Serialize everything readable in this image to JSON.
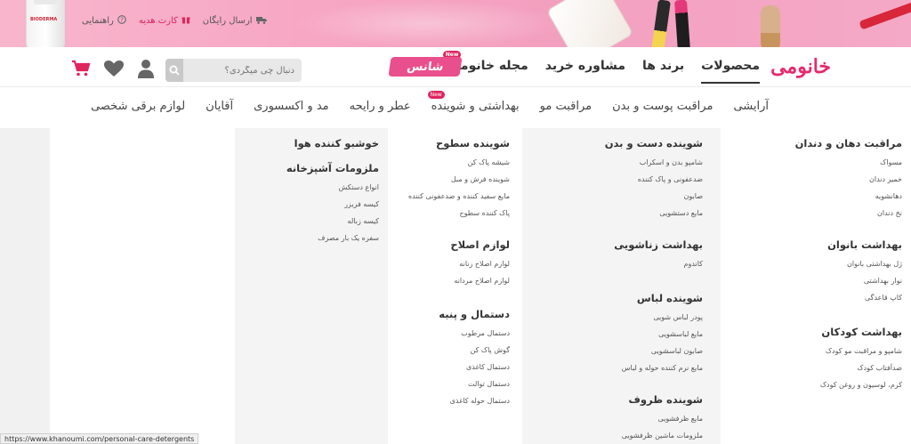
{
  "topbar": {
    "links": [
      {
        "label": "ارسال رایگان",
        "icon": "truck-icon"
      },
      {
        "label": "کارت هدیه",
        "icon": "gift-icon"
      },
      {
        "label": "راهنمایی",
        "icon": "question-icon"
      }
    ],
    "bottle_label": "BIODERMA"
  },
  "header": {
    "logo": "خانومی",
    "nav": [
      {
        "label": "محصولات",
        "active": true
      },
      {
        "label": "برند ها"
      },
      {
        "label": "مشاوره خرید"
      },
      {
        "label": "مجله خانومی",
        "badge": "New"
      }
    ],
    "chance": "شانس",
    "search_placeholder": "دنبال چی میگردی؟",
    "icons": [
      "search-icon",
      "user-icon",
      "heart-icon",
      "cart-icon"
    ],
    "accent": "#e0245e"
  },
  "categories": [
    {
      "label": "آرایشی"
    },
    {
      "label": "مراقبت پوست و بدن"
    },
    {
      "label": "مراقبت مو"
    },
    {
      "label": "بهداشتی و شوینده",
      "badge": "New"
    },
    {
      "label": "عطر و رایحه"
    },
    {
      "label": "مد و اکسسوری"
    },
    {
      "label": "آقایان"
    },
    {
      "label": "لوازم برقی شخصی"
    }
  ],
  "menu": {
    "col1": [
      {
        "title": "مراقبت دهان و دندان",
        "items": [
          "مسواک",
          "خمیر دندان",
          "دهانشویه",
          "نخ دندان"
        ]
      },
      {
        "title": "بهداشت بانوان",
        "items": [
          "ژل بهداشتی بانوان",
          "نوار بهداشتی",
          "کاپ قاعدگی"
        ]
      },
      {
        "title": "بهداشت کودکان",
        "items": [
          "شامپو و مراقبت مو کودک",
          "ضدآفتاب کودک",
          "کرم، لوسیون و روغن کودک"
        ]
      }
    ],
    "col2": [
      {
        "title": "شوینده دست و بدن",
        "items": [
          "شامپو بدن و اسکراب",
          "ضدعفونی و پاک کننده",
          "صابون",
          "مایع دستشویی"
        ]
      },
      {
        "title": "بهداشت زناشویی",
        "items": [
          "کاندوم"
        ]
      },
      {
        "title": "شوینده لباس",
        "items": [
          "پودر لباس شویی",
          "مایع لباسشویی",
          "صابون لباسشویی",
          "مایع نرم کننده حوله و لباس"
        ]
      },
      {
        "title": "شوینده ظروف",
        "items": [
          "مایع ظرفشویی",
          "ملزومات ماشین ظرفشویی"
        ]
      }
    ],
    "col3": [
      {
        "title": "شوینده سطوح",
        "items": [
          "شیشه پاک کن",
          "شوینده فرش و مبل",
          "مایع سفید کننده و ضدعفونی کننده",
          "پاک کننده سطوح"
        ]
      },
      {
        "title": "لوازم اصلاح",
        "items": [
          "لوازم اصلاح زنانه",
          "لوازم اصلاح مردانه"
        ]
      },
      {
        "title": "دستمال و پنبه",
        "items": [
          "دستمال مرطوب",
          "گوش پاک کن",
          "دستمال کاغذی",
          "دستمال توالت",
          "دستمال حوله کاغذی"
        ]
      }
    ],
    "col4": [
      {
        "title": "خوشبو کننده هوا",
        "items": []
      },
      {
        "title": "ملزومات آشپزخانه",
        "items": [
          "انواع دستکش",
          "کیسه فریزر",
          "کیسه زباله",
          "سفره یک بار مصرف"
        ]
      }
    ]
  },
  "status_url": "https://www.khanoumi.com/personal-care-detergents"
}
